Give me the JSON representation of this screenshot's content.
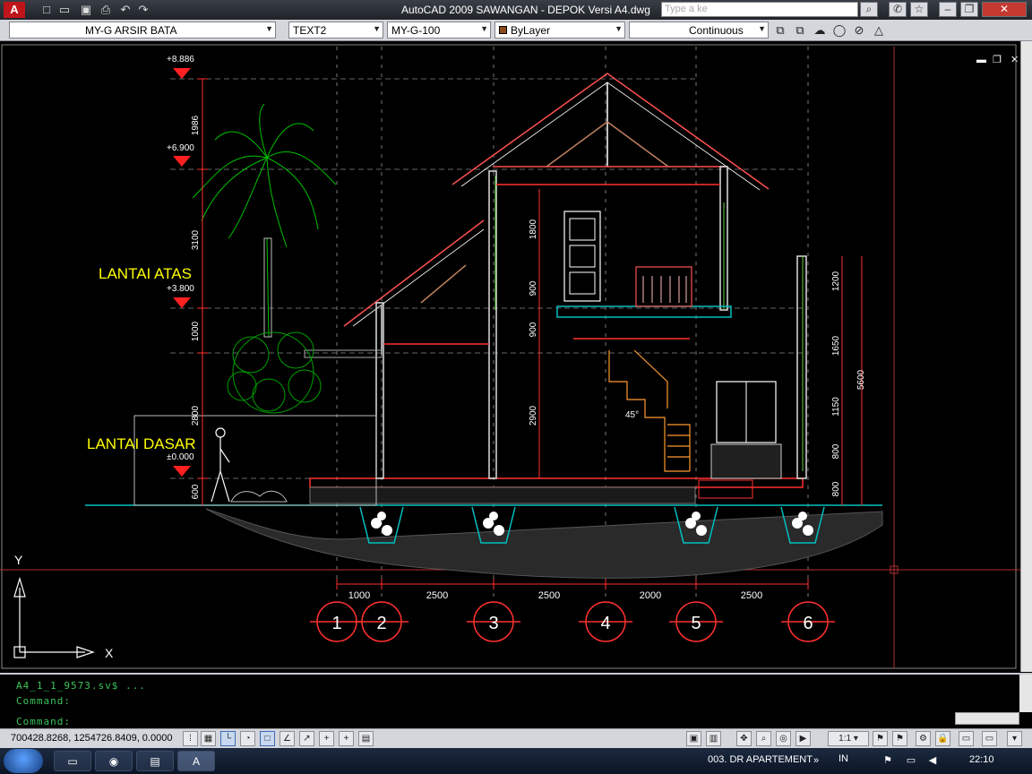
{
  "window": {
    "title": "AutoCAD 2009 SAWANGAN - DEPOK Versi A4.dwg",
    "app_logo": "A"
  },
  "search": {
    "placeholder": "Type a ke"
  },
  "properties": {
    "layer": "MY-G ARSIR BATA",
    "text_style": "TEXT2",
    "dim_style": "MY-G-100",
    "color": "ByLayer",
    "linetype": "Continuous"
  },
  "drawing": {
    "labels": {
      "lantai_atas": "LANTAI ATAS",
      "lantai_dasar": "LANTAI DASAR"
    },
    "levels": [
      "+8.886",
      "+6.900",
      "+3.800",
      "±0.000"
    ],
    "left_dims": [
      "1986",
      "3100",
      "1000",
      "2800",
      "600"
    ],
    "inner_dims": [
      "1800",
      "900",
      "900",
      "2900"
    ],
    "right_dims": [
      "1200",
      "1650",
      "1150",
      "800",
      "800"
    ],
    "total_dim": "5600",
    "stair_angle": "45°",
    "bottom_dims": [
      "1000",
      "2500",
      "2500",
      "2000",
      "2500"
    ],
    "grid_labels": [
      "1",
      "2",
      "3",
      "4",
      "5",
      "6"
    ],
    "ucs": {
      "y": "Y",
      "x": "X"
    }
  },
  "command": {
    "lines": [
      "A4_1_1_9573.sv$ ...",
      "Command:",
      "Command:"
    ]
  },
  "status": {
    "coords": "700428.8268, 1254726.8409, 0.0000",
    "scale": "1:1"
  },
  "taskbar": {
    "label": "003. DR APARTEMENT",
    "lang": "IN",
    "clock": "22:10"
  },
  "colors": {
    "accent": "#c0141b",
    "cad_bg": "#000000",
    "yellow_text": "#ffff00",
    "tree_green": "#00c000",
    "structure_red": "#ff0000"
  }
}
